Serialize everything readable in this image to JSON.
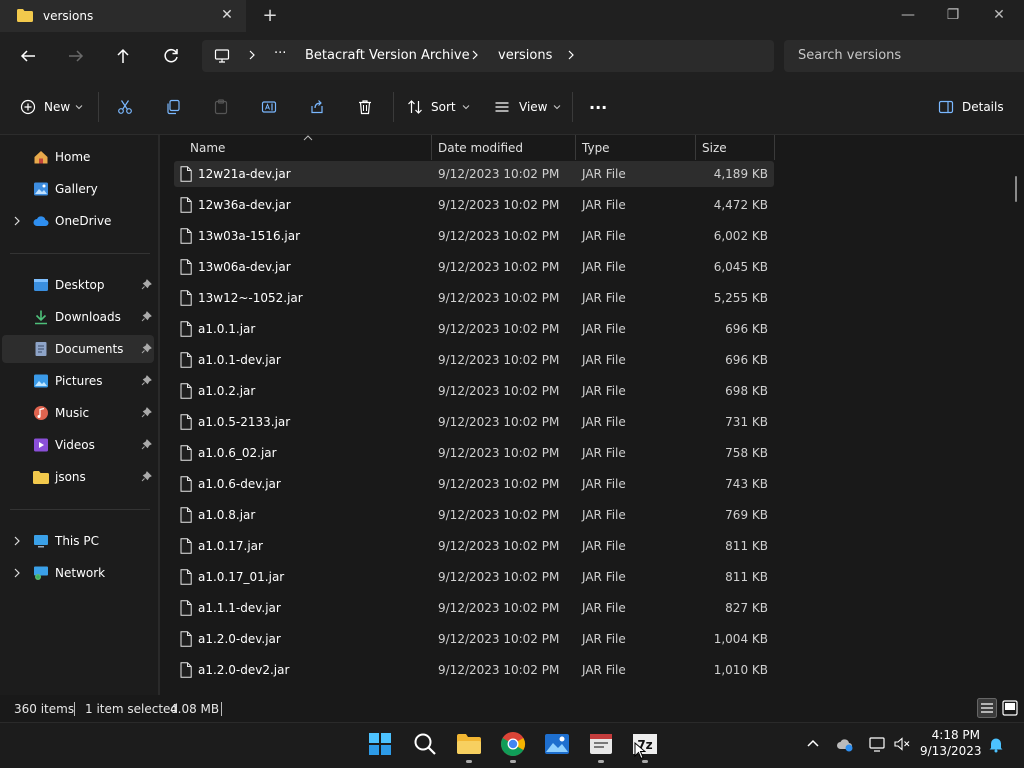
{
  "window": {
    "tab_title": "versions",
    "tab_close": "✕",
    "new_tab": "+",
    "minimize": "—",
    "maximize": "❐",
    "close": "✕"
  },
  "address": {
    "more": "···",
    "crumbs": [
      "Betacraft Version Archive",
      "versions"
    ],
    "search_placeholder": "Search versions"
  },
  "commands": {
    "new_label": "New",
    "sort_label": "Sort",
    "view_label": "View",
    "more": "···",
    "details_label": "Details"
  },
  "sidebar": {
    "items": [
      {
        "label": "Home"
      },
      {
        "label": "Gallery"
      },
      {
        "label": "OneDrive"
      },
      {
        "label": "Desktop"
      },
      {
        "label": "Downloads"
      },
      {
        "label": "Documents"
      },
      {
        "label": "Pictures"
      },
      {
        "label": "Music"
      },
      {
        "label": "Videos"
      },
      {
        "label": "jsons"
      },
      {
        "label": "This PC"
      },
      {
        "label": "Network"
      }
    ]
  },
  "list": {
    "columns": {
      "name": "Name",
      "date": "Date modified",
      "type": "Type",
      "size": "Size"
    },
    "rows": [
      {
        "name": "12w21a-dev.jar",
        "date": "9/12/2023 10:02 PM",
        "type": "JAR File",
        "size": "4,189 KB"
      },
      {
        "name": "12w36a-dev.jar",
        "date": "9/12/2023 10:02 PM",
        "type": "JAR File",
        "size": "4,472 KB"
      },
      {
        "name": "13w03a-1516.jar",
        "date": "9/12/2023 10:02 PM",
        "type": "JAR File",
        "size": "6,002 KB"
      },
      {
        "name": "13w06a-dev.jar",
        "date": "9/12/2023 10:02 PM",
        "type": "JAR File",
        "size": "6,045 KB"
      },
      {
        "name": "13w12~-1052.jar",
        "date": "9/12/2023 10:02 PM",
        "type": "JAR File",
        "size": "5,255 KB"
      },
      {
        "name": "a1.0.1.jar",
        "date": "9/12/2023 10:02 PM",
        "type": "JAR File",
        "size": "696 KB"
      },
      {
        "name": "a1.0.1-dev.jar",
        "date": "9/12/2023 10:02 PM",
        "type": "JAR File",
        "size": "696 KB"
      },
      {
        "name": "a1.0.2.jar",
        "date": "9/12/2023 10:02 PM",
        "type": "JAR File",
        "size": "698 KB"
      },
      {
        "name": "a1.0.5-2133.jar",
        "date": "9/12/2023 10:02 PM",
        "type": "JAR File",
        "size": "731 KB"
      },
      {
        "name": "a1.0.6_02.jar",
        "date": "9/12/2023 10:02 PM",
        "type": "JAR File",
        "size": "758 KB"
      },
      {
        "name": "a1.0.6-dev.jar",
        "date": "9/12/2023 10:02 PM",
        "type": "JAR File",
        "size": "743 KB"
      },
      {
        "name": "a1.0.8.jar",
        "date": "9/12/2023 10:02 PM",
        "type": "JAR File",
        "size": "769 KB"
      },
      {
        "name": "a1.0.17.jar",
        "date": "9/12/2023 10:02 PM",
        "type": "JAR File",
        "size": "811 KB"
      },
      {
        "name": "a1.0.17_01.jar",
        "date": "9/12/2023 10:02 PM",
        "type": "JAR File",
        "size": "811 KB"
      },
      {
        "name": "a1.1.1-dev.jar",
        "date": "9/12/2023 10:02 PM",
        "type": "JAR File",
        "size": "827 KB"
      },
      {
        "name": "a1.2.0-dev.jar",
        "date": "9/12/2023 10:02 PM",
        "type": "JAR File",
        "size": "1,004 KB"
      },
      {
        "name": "a1.2.0-dev2.jar",
        "date": "9/12/2023 10:02 PM",
        "type": "JAR File",
        "size": "1,010 KB"
      }
    ]
  },
  "status": {
    "item_count": "360 items",
    "selection": "1 item selected",
    "selection_size": "4.08 MB"
  },
  "taskbar": {
    "time": "4:18 PM",
    "date": "9/13/2023"
  },
  "colors": {
    "folder": "#f2c94c",
    "accent": "#4cc2ff",
    "selected_row": "#2d2d2d"
  }
}
